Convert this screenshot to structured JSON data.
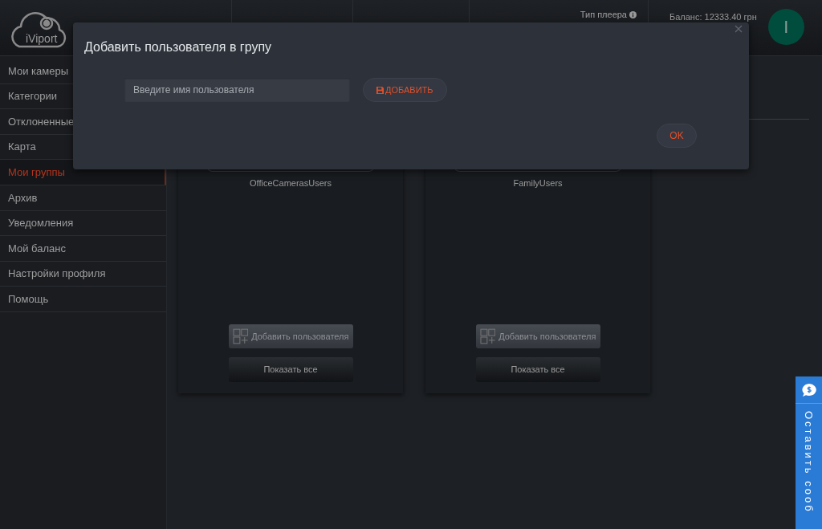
{
  "logo": {
    "text": "iViport"
  },
  "header": {
    "player_type": "Тип плеера",
    "balance": "Баланс: 12333.40 грн",
    "avatar_letter": "I"
  },
  "sidebar": {
    "items": [
      {
        "label": "Мои камеры",
        "selected": false
      },
      {
        "label": "Категории",
        "selected": false
      },
      {
        "label": "Отклоненные",
        "selected": false
      },
      {
        "label": "Карта",
        "selected": false
      },
      {
        "label": "Мои группы",
        "selected": true
      },
      {
        "label": "Архив",
        "selected": false
      },
      {
        "label": "Уведомления",
        "selected": false
      },
      {
        "label": "Мой баланс",
        "selected": false
      },
      {
        "label": "Настройки профиля",
        "selected": false
      },
      {
        "label": "Помощь",
        "selected": false
      }
    ]
  },
  "groups": [
    {
      "name": "OfficeCamerasUsers",
      "add_label": "Добавить пользователя",
      "show_all": "Показать все"
    },
    {
      "name": "FamilyUsers",
      "add_label": "Добавить пользователя",
      "show_all": "Показать все"
    }
  ],
  "modal": {
    "title": "Добавить пользователя в групу",
    "placeholder": "Введите имя пользователя",
    "add_button": "ДОБАВИТЬ",
    "ok_button": "OK"
  },
  "feedback_tab": {
    "label": "Оставить сооб"
  }
}
